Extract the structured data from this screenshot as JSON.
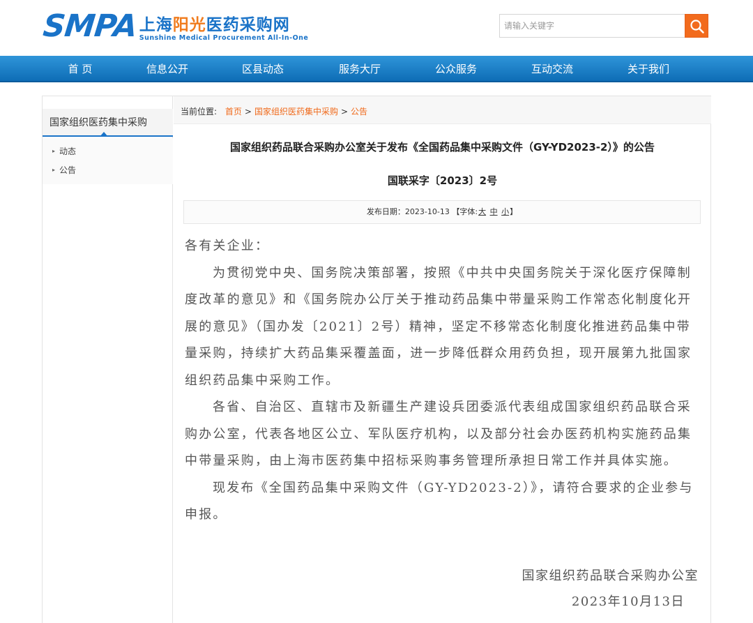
{
  "header": {
    "logo": {
      "abbr": "SMPA",
      "cn_part1": "上海",
      "cn_part2": "阳光",
      "cn_part3": "医药采购网",
      "en": "Sunshine Medical Procurement All-In-One"
    },
    "search": {
      "placeholder": "请输入关键字",
      "icon": "search-icon"
    }
  },
  "nav": {
    "items": [
      "首 页",
      "信息公开",
      "区县动态",
      "服务大厅",
      "公众服务",
      "互动交流",
      "关于我们"
    ]
  },
  "sidebar": {
    "title": "国家组织医药集中采购",
    "items": [
      "动态",
      "公告"
    ]
  },
  "breadcrumb": {
    "prefix": "当前位置:",
    "home": "首页",
    "sep": ">",
    "level1": "国家组织医药集中采购",
    "level2": "公告"
  },
  "article": {
    "title": "国家组织药品联合采购办公室关于发布《全国药品集中采购文件（GY-YD2023-2）》的公告",
    "doc_no": "国联采字〔2023〕2号",
    "meta_prefix": "发布日期：2023-10-13 【字体:",
    "font_large": "大",
    "font_medium": "中",
    "font_small": "小",
    "meta_suffix": "】",
    "salutation": "各有关企业：",
    "paragraphs": [
      "为贯彻党中央、国务院决策部署，按照《中共中央国务院关于深化医疗保障制度改革的意见》和《国务院办公厅关于推动药品集中带量采购工作常态化制度化开展的意见》（国办发〔2021〕2号）精神，坚定不移常态化制度化推进药品集中带量采购，持续扩大药品集采覆盖面，进一步降低群众用药负担，现开展第九批国家组织药品集中采购工作。",
      "各省、自治区、直辖市及新疆生产建设兵团委派代表组成国家组织药品联合采购办公室，代表各地区公立、军队医疗机构，以及部分社会办医药机构实施药品集中带量采购，由上海市医药集中招标采购事务管理所承担日常工作并具体实施。",
      "现发布《全国药品集中采购文件（GY-YD2023-2）》，请符合要求的企业参与申报。"
    ],
    "signature_org": "国家组织药品联合采购办公室",
    "signature_date": "2023年10月13日"
  },
  "colors": {
    "brand_blue": "#1a73c8",
    "brand_orange": "#f07c1e",
    "nav_blue": "#1a7fc8",
    "link_orange": "#f06a1b"
  }
}
